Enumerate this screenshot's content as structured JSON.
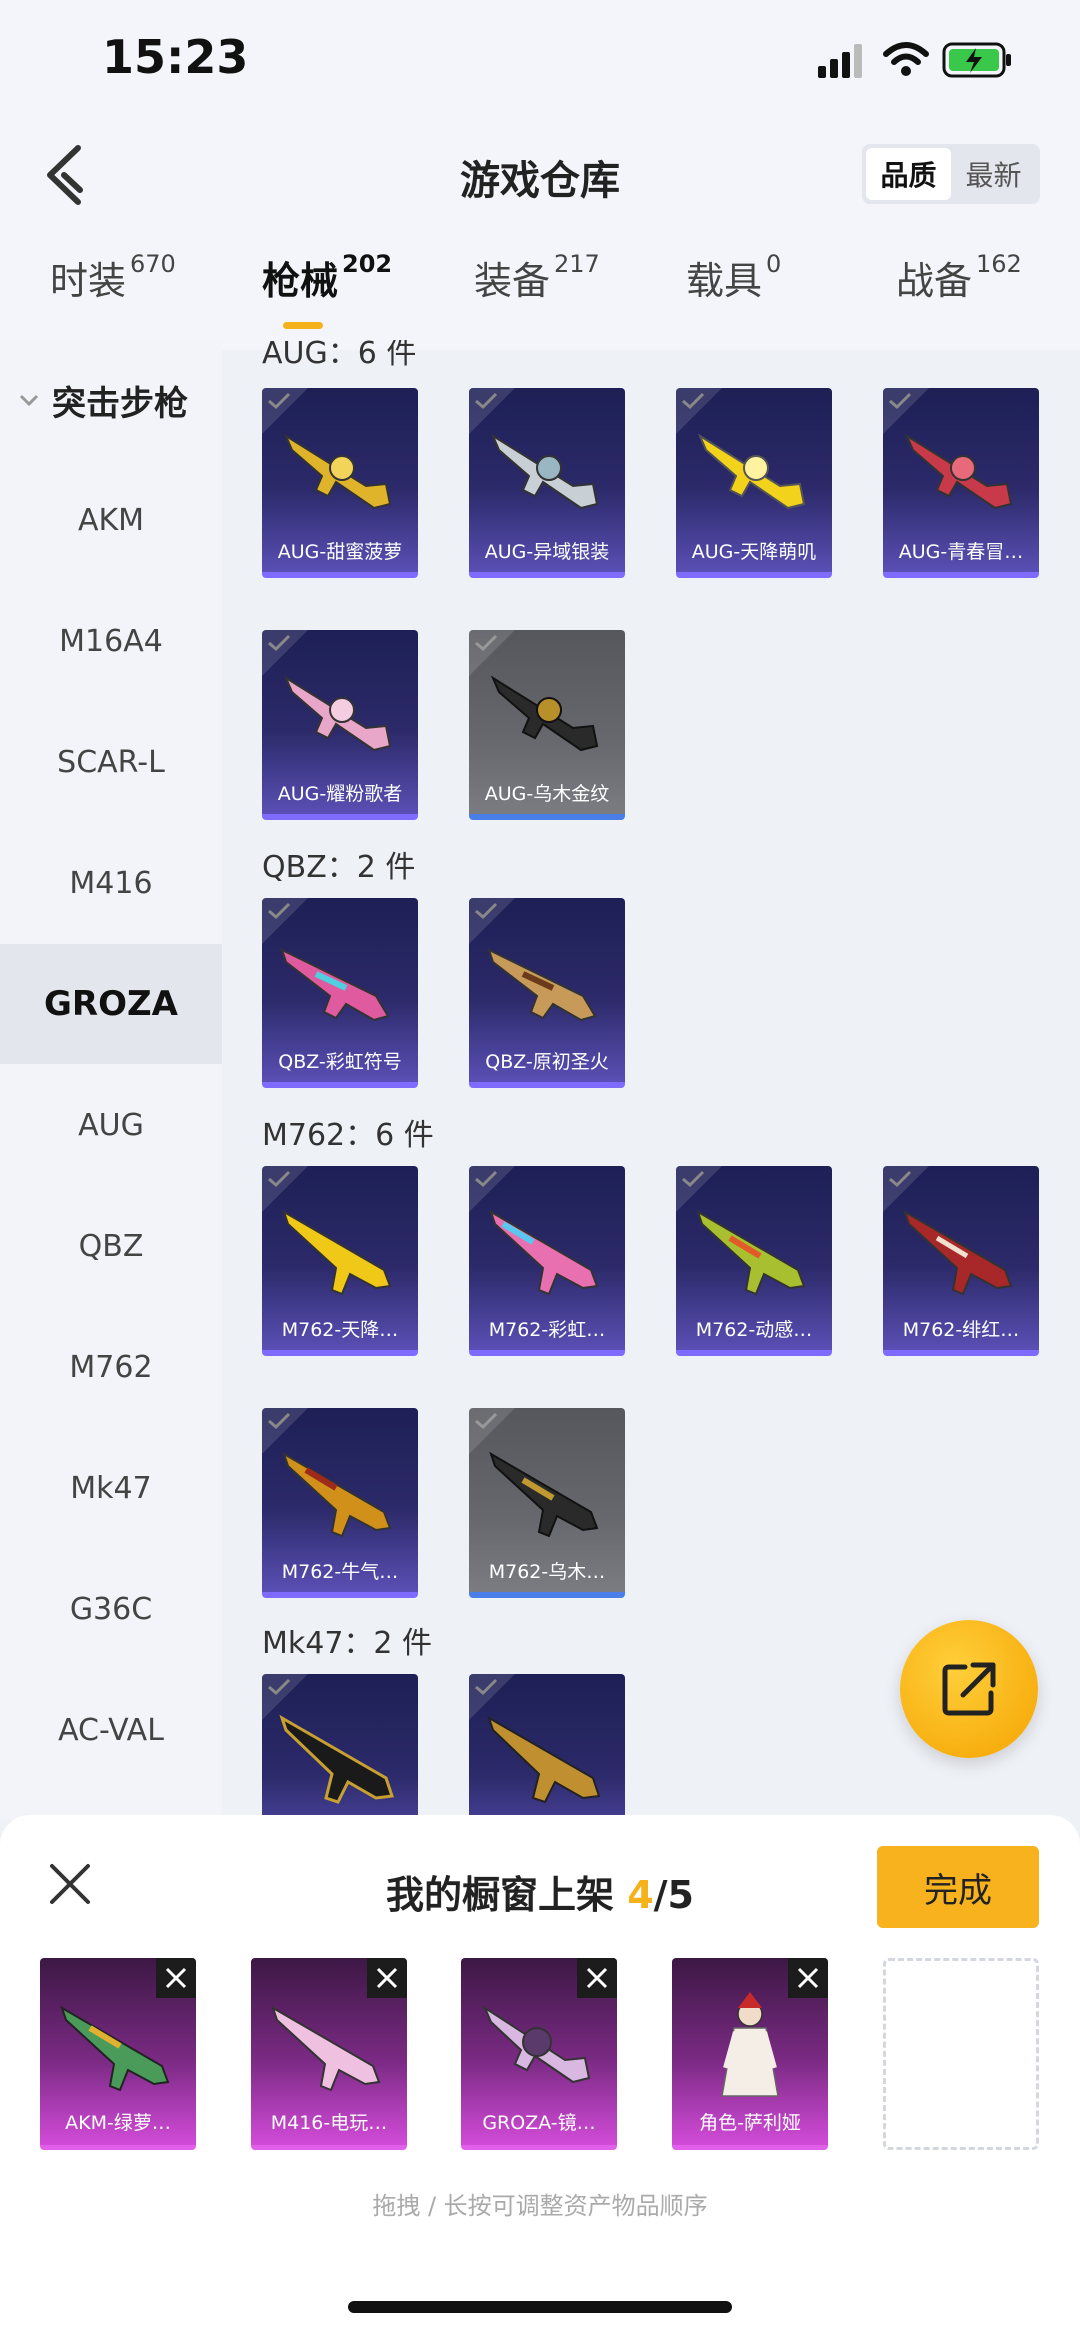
{
  "status_bar": {
    "time": "15:23"
  },
  "header": {
    "title": "游戏仓库",
    "sort_options": [
      "品质",
      "最新"
    ],
    "sort_active": "品质"
  },
  "tabs": [
    {
      "label": "时装",
      "count": "670"
    },
    {
      "label": "枪械",
      "count": "202"
    },
    {
      "label": "装备",
      "count": "217"
    },
    {
      "label": "载具",
      "count": "0"
    },
    {
      "label": "战备",
      "count": "162"
    }
  ],
  "sidebar": {
    "heading": "突击步枪",
    "items": [
      "AKM",
      "M16A4",
      "SCAR-L",
      "M416",
      "GROZA",
      "AUG",
      "QBZ",
      "M762",
      "Mk47",
      "G36C",
      "AC-VAL"
    ],
    "active": "GROZA"
  },
  "groups": {
    "aug": {
      "title": "AUG：6 件",
      "items": [
        "AUG-甜蜜菠萝",
        "AUG-异域银装",
        "AUG-天降萌叽",
        "AUG-青春冒…",
        "AUG-耀粉歌者",
        "AUG-乌木金纹"
      ]
    },
    "qbz": {
      "title": "QBZ：2 件",
      "items": [
        "QBZ-彩虹符号",
        "QBZ-原初圣火"
      ]
    },
    "m762": {
      "title": "M762：6 件",
      "items": [
        "M762-天降…",
        "M762-彩虹…",
        "M762-动感…",
        "M762-绯红…",
        "M762-牛气…",
        "M762-乌木…"
      ]
    },
    "mk47": {
      "title": "Mk47：2 件",
      "items": [
        "",
        ""
      ]
    }
  },
  "sheet": {
    "title_prefix": "我的橱窗上架 ",
    "count": "4",
    "total": "/5",
    "done_label": "完成",
    "slots": [
      "AKM-绿萝…",
      "M416-电玩…",
      "GROZA-镜…",
      "角色-萨利娅"
    ],
    "hint": "拖拽 / 长按可调整资产物品顺序"
  },
  "colors": {
    "accent": "#f6b21a",
    "card_purple": "#2c2a6a",
    "card_gray": "#66686e",
    "showcase_magenta": "#d24bd8"
  },
  "icons": [
    "back-icon",
    "signal-icon",
    "wifi-icon",
    "battery-icon",
    "chevron-down-icon",
    "checkmark-icon",
    "share-icon",
    "close-icon"
  ]
}
